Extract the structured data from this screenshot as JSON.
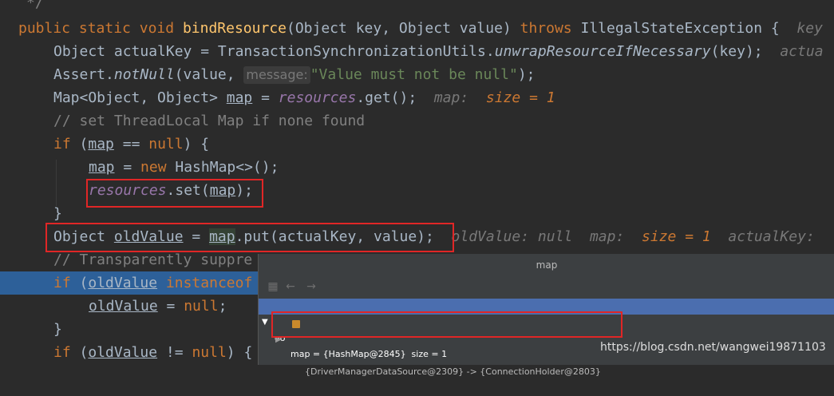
{
  "code": {
    "l0": {
      "comment": "*/"
    },
    "l1": {
      "kw_public": "public",
      "kw_static": "static",
      "kw_void": "void",
      "method": "bindResource",
      "params": "(Object key, Object value) ",
      "kw_throws": "throws",
      "exc": " IllegalStateException {",
      "hint": "key"
    },
    "l2": {
      "pre": "Object actualKey = TransactionSynchronizationUtils.",
      "call": "unwrapResourceIfNecessary",
      "post": "(key);",
      "hint": "actua"
    },
    "l3": {
      "pre": "Assert.",
      "call": "notNull",
      "mid": "(value, ",
      "param_label": "message:",
      "str": "\"Value must not be null\"",
      "post": ");"
    },
    "l4": {
      "pre": "Map<Object, Object> ",
      "var": "map",
      "eq": " = ",
      "field": "resources",
      "post": ".get();",
      "hint": "map:",
      "hint_val": "size = 1"
    },
    "l5": {
      "comment": "// set ThreadLocal Map if none found"
    },
    "l6": {
      "kw": "if",
      "open": " (",
      "var": "map",
      "mid": " == ",
      "kw_null": "null",
      "post": ") {"
    },
    "l7": {
      "var": "map",
      "mid": " = ",
      "kw_new": "new",
      "post": " HashMap<>();"
    },
    "l8": {
      "field": "resources",
      "mid": ".set(",
      "var": "map",
      "post": ");"
    },
    "l9": {
      "text": "}"
    },
    "l10": {
      "pre": "Object ",
      "var": "oldValue",
      "eq": " = ",
      "map": "map",
      "post": ".put(actualKey, value);",
      "hint1": "oldValue:",
      "hint1_val": "null",
      "hint2": "map:",
      "hint2_val": "size = 1",
      "hint3": "actualKey:"
    },
    "l11": {
      "comment": "// Transparently suppre"
    },
    "l12": {
      "kw": "if",
      "open": " (",
      "var": "oldValue",
      "sp": " ",
      "kw_inst": "instanceof"
    },
    "l13": {
      "var": "oldValue",
      "mid": " = ",
      "kw_null": "null",
      "post": ";"
    },
    "l14": {
      "text": "}"
    },
    "l15": {
      "kw": "if",
      "open": " (",
      "var": "oldValue",
      "mid": " != ",
      "kw_null": "null",
      "post": ") {"
    }
  },
  "popup": {
    "title": "map",
    "back_icon": "arrow-left",
    "forward_icon": "arrow-right",
    "row1": "map = {HashMap@2845}  size = 1",
    "row2": "{DriverManagerDataSource@2309} -> {ConnectionHolder@2803}"
  },
  "watermark": "https://blog.csdn.net/wangwei19871103",
  "colors": {
    "background": "#2b2b2b",
    "keyword": "#cc7832",
    "method": "#ffc66d",
    "field": "#9876aa",
    "string": "#6a8759",
    "comment": "#808080",
    "highlight_line": "#2d6099",
    "annotation_box": "#e02626",
    "selected_row": "#4b6eaf"
  }
}
